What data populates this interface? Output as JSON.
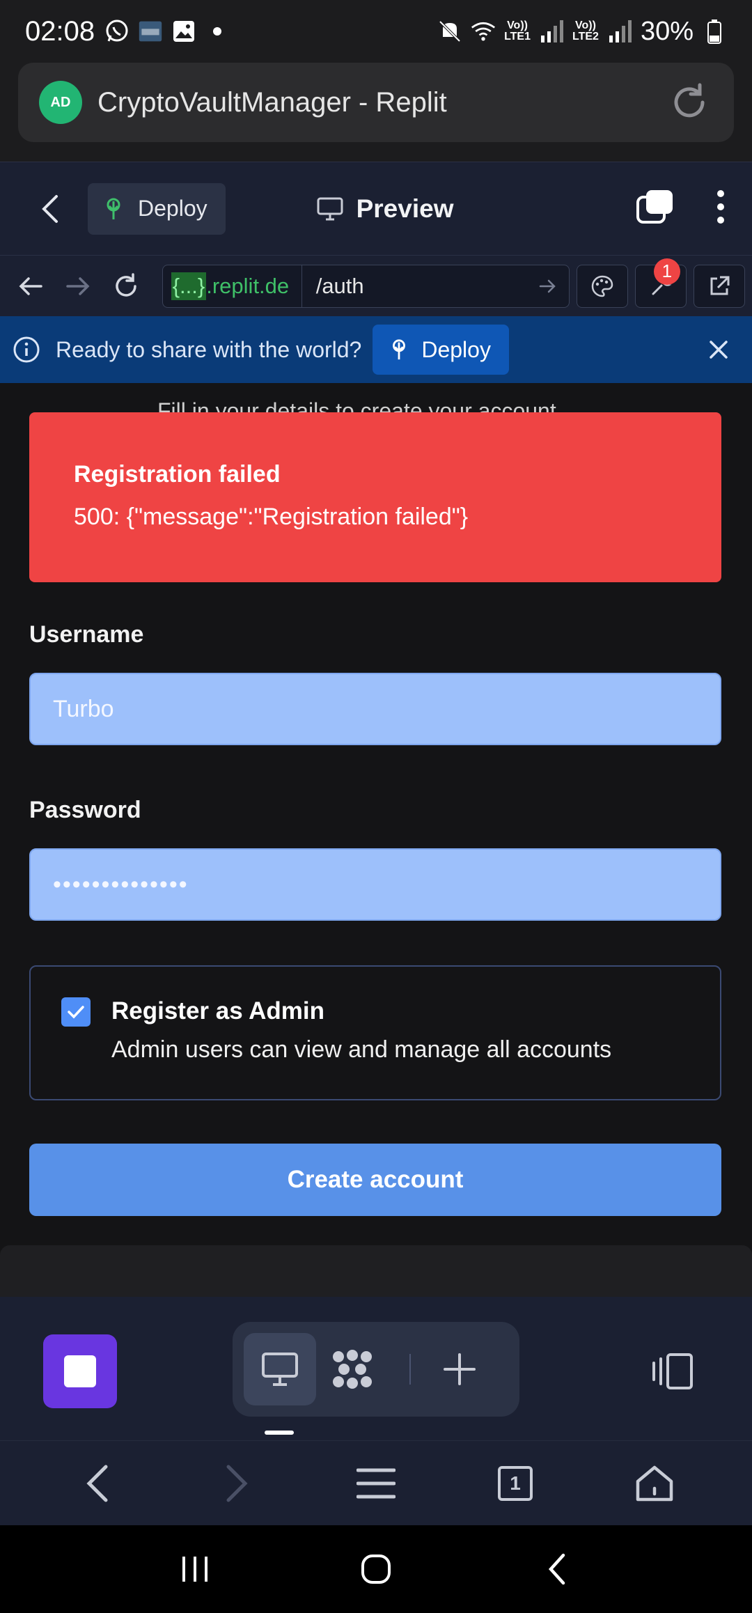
{
  "status_bar": {
    "time": "02:08",
    "battery": "30%",
    "sim1": "LTE1",
    "sim2": "LTE2"
  },
  "browser": {
    "tab_title": "CryptoVaultManager - Replit",
    "site_badge": "AD"
  },
  "replit_bar": {
    "deploy_label": "Deploy",
    "preview_label": "Preview"
  },
  "webview": {
    "host_highlight": "{...}",
    "host_rest": ".replit.de",
    "path": "/auth",
    "notification_count": "1"
  },
  "banner": {
    "text": "Ready to share with the world?",
    "deploy_label": "Deploy"
  },
  "page": {
    "clipped_text": "Fill in your details to create your account",
    "error": {
      "title": "Registration failed",
      "message": "500: {\"message\":\"Registration failed\"}"
    },
    "username": {
      "label": "Username",
      "value": "Turbo"
    },
    "password": {
      "label": "Password",
      "value": "••••••••••••••"
    },
    "admin": {
      "checked": true,
      "title": "Register as Admin",
      "description": "Admin users can view and manage all accounts"
    },
    "submit_label": "Create account"
  },
  "browser_nav": {
    "tab_count": "1"
  },
  "colors": {
    "error": "#ef4444",
    "input": "#9dc0fb",
    "primary": "#5891e8",
    "stop": "#6936e0",
    "banner": "#0a3b78"
  }
}
